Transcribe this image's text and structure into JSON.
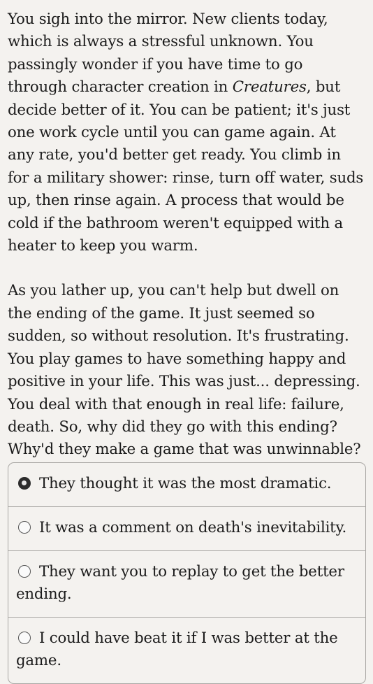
{
  "story": {
    "p1_before": "You sigh into the mirror. New clients today, which is always a stressful unknown. You passingly wonder if you have time to go through character creation in ",
    "p1_italic": "Creatures",
    "p1_after": ", but decide better of it. You can be patient; it's just one work cycle until you can game again. At any rate, you'd better get ready. You climb in for a military shower: rinse, turn off water, suds up, then rinse again. A process that would be cold if the bathroom weren't equipped with a heater to keep you warm.",
    "p2": "As you lather up, you can't help but dwell on the ending of the game. It just seemed so sudden, so without resolution. It's frustrating. You play games to have something happy and positive in your life. This was just... depressing. You deal with that enough in real life: failure, death. So, why did they go with this ending? Why'd they make a game that was unwinnable?"
  },
  "choices": [
    {
      "label": "They thought it was the most dramatic.",
      "selected": true
    },
    {
      "label": "It was a comment on death's inevitability.",
      "selected": false
    },
    {
      "label": "They want you to replay to get the better ending.",
      "selected": false
    },
    {
      "label": "I could have beat it if I was better at the game.",
      "selected": false
    }
  ]
}
